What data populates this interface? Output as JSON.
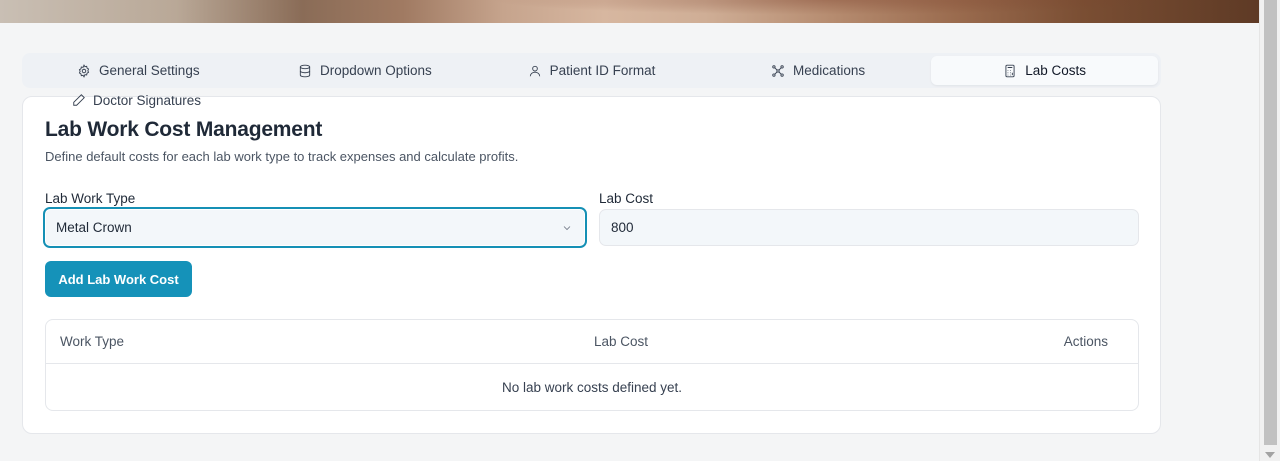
{
  "tabs": [
    {
      "label": "General Settings",
      "icon": "gear-icon"
    },
    {
      "label": "Dropdown Options",
      "icon": "database-icon"
    },
    {
      "label": "Patient ID Format",
      "icon": "user-icon"
    },
    {
      "label": "Medications",
      "icon": "network-icon"
    },
    {
      "label": "Lab Costs",
      "icon": "calculator-icon",
      "active": true
    },
    {
      "label": "Doctor Signatures",
      "icon": "pen-icon"
    }
  ],
  "card": {
    "title": "Lab Work Cost Management",
    "description": "Define default costs for each lab work type to track expenses and calculate profits."
  },
  "form": {
    "work_type_label": "Lab Work Type",
    "work_type_value": "Metal Crown",
    "cost_label": "Lab Cost",
    "cost_value": "800",
    "add_button": "Add Lab Work Cost"
  },
  "table": {
    "columns": [
      "Work Type",
      "Lab Cost",
      "Actions"
    ],
    "empty_message": "No lab work costs defined yet."
  },
  "colors": {
    "accent": "#1592b9",
    "focus_border": "#1590b5"
  }
}
